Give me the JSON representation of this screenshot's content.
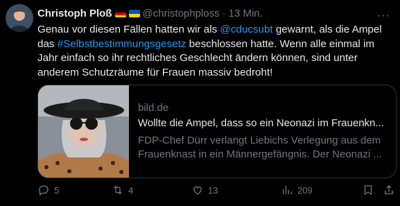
{
  "tweet": {
    "author_name": "Christoph Ploß",
    "handle": "@christophploss",
    "separator": "·",
    "time": "13 Min.",
    "more_label": "···",
    "text_parts": [
      "Genau vor diesen Fällen hatten wir als ",
      "@cducsubt",
      " gewarnt, als die Ampel das ",
      "#Selbstbestimmungsgesetz",
      " beschlossen hatte. Wenn alle einmal im Jahr einfach so ihr rechtliches Geschlecht ändern können, sind unter anderem Schutzräume für Frauen massiv bedroht!"
    ]
  },
  "card": {
    "domain": "bild.de",
    "title": "Wollte die Ampel, dass so ein Neonazi im Frauenkn...",
    "description": "FDP-Chef Dürr verlangt Liebichs Verlegung aus dem Frauenknast in ein Männergefängnis. Der Neonazi ..."
  },
  "actions": {
    "replies": "5",
    "reposts": "4",
    "likes": "13",
    "views": "209"
  },
  "colors": {
    "background": "#000000",
    "text": "#e7e9ea",
    "muted": "#71767b",
    "link": "#1d9bf0",
    "border": "#2f3336"
  },
  "icons": [
    "more-icon",
    "reply-icon",
    "repost-icon",
    "like-icon",
    "views-icon",
    "bookmark-icon",
    "share-icon",
    "flag-germany-icon",
    "flag-ukraine-icon"
  ]
}
